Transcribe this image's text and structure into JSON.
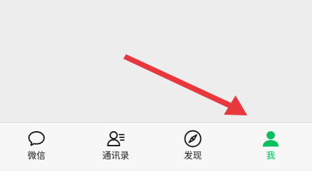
{
  "colors": {
    "accent": "#07c160",
    "annotation_arrow": "#e8383d",
    "background": "#ededed",
    "tabbar_background": "#f7f7f7"
  },
  "tabbar": {
    "tabs": [
      {
        "label": "微信",
        "icon": "chat-bubble-icon",
        "active": false
      },
      {
        "label": "通讯录",
        "icon": "contacts-icon",
        "active": false
      },
      {
        "label": "发现",
        "icon": "compass-icon",
        "active": false
      },
      {
        "label": "我",
        "icon": "person-icon",
        "active": true
      }
    ]
  }
}
